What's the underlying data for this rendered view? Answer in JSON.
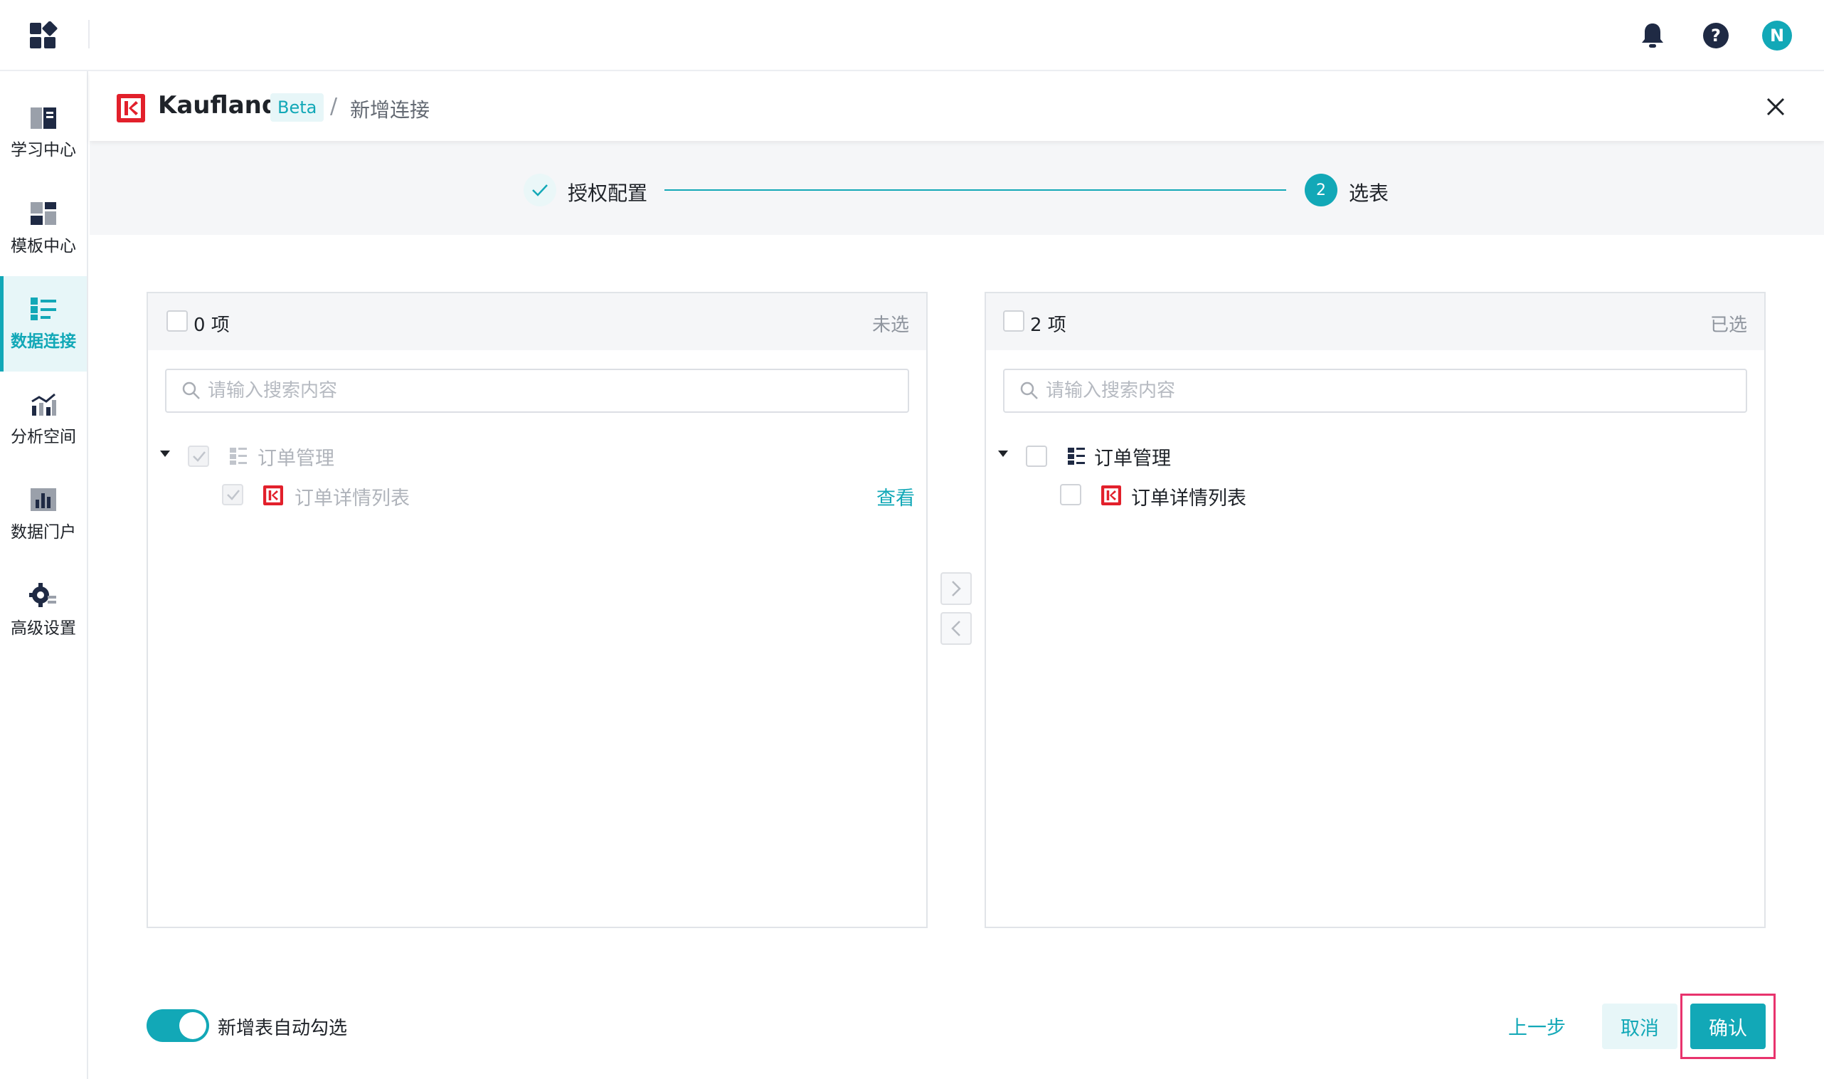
{
  "nav": {
    "items": [
      {
        "label": "学习中心",
        "icon": "book-icon"
      },
      {
        "label": "模板中心",
        "icon": "template-icon"
      },
      {
        "label": "数据连接",
        "icon": "data-connection-icon",
        "active": true
      },
      {
        "label": "分析空间",
        "icon": "analysis-icon"
      },
      {
        "label": "数据门户",
        "icon": "portal-icon"
      },
      {
        "label": "高级设置",
        "icon": "gear-icon"
      }
    ]
  },
  "topbar": {
    "avatar_initial": "N",
    "icons": [
      "apps-grid-icon",
      "bell-icon",
      "help-icon"
    ]
  },
  "dialog": {
    "brand": "Kaufland",
    "badge": "Beta",
    "separator": "/",
    "breadcrumb": "新增连接"
  },
  "steps": [
    {
      "label": "授权配置",
      "status": "done"
    },
    {
      "number": "2",
      "label": "选表",
      "status": "active"
    }
  ],
  "left_panel": {
    "count": "0 项",
    "status": "未选",
    "search_placeholder": "请输入搜索内容",
    "group": "订单管理",
    "item": "订单详情列表",
    "view_link": "查看"
  },
  "right_panel": {
    "count": "2 项",
    "status": "已选",
    "search_placeholder": "请输入搜索内容",
    "group": "订单管理",
    "item": "订单详情列表"
  },
  "transfer_buttons": {
    "to_right": ">",
    "to_left": "<"
  },
  "footer": {
    "auto_select_label": "新增表自动勾选",
    "auto_select_on": true,
    "prev_label": "上一步",
    "cancel_label": "取消",
    "confirm_label": "确认"
  },
  "colors": {
    "accent": "#12a8b7",
    "brand_red": "#e2202b",
    "highlight": "#e8336d"
  }
}
